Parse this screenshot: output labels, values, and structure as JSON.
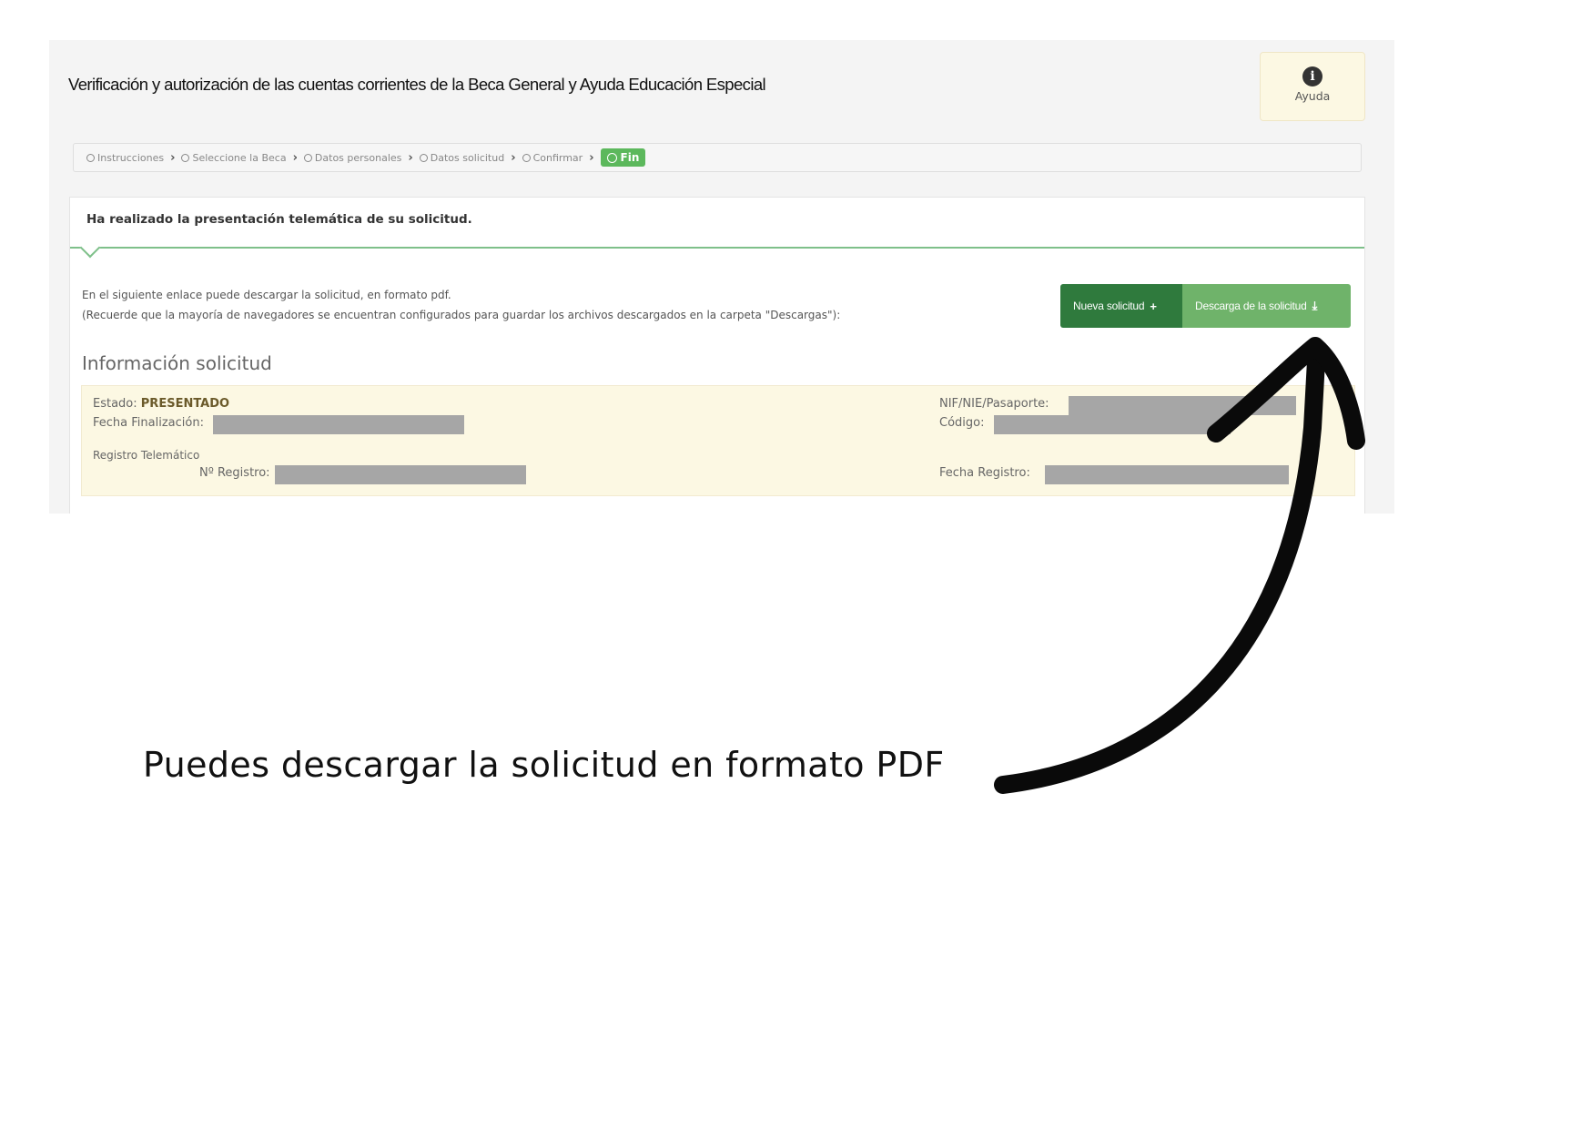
{
  "app": {
    "title": "Verificación y autorización de las cuentas corrientes de la Beca General y Ayuda Educación Especial",
    "help_label": "Ayuda",
    "help_icon": "info-circle-icon"
  },
  "steps": {
    "items": [
      {
        "label": "Instrucciones"
      },
      {
        "label": "Seleccione la Beca"
      },
      {
        "label": "Datos personales"
      },
      {
        "label": "Datos solicitud"
      },
      {
        "label": "Confirmar"
      }
    ],
    "current": "Fin"
  },
  "panel": {
    "heading": "Ha realizado la presentación telemática de su solicitud.",
    "line1": "En el siguiente enlace puede descargar la solicitud, en formato pdf.",
    "line2": "(Recuerde que la mayoría de navegadores se encuentran configurados para guardar los archivos descargados en la carpeta \"Descargas\"):",
    "buttons": {
      "new_label": "Nueva solicitud",
      "new_icon": "+",
      "download_label": "Descarga de la solicitud",
      "download_icon": "⤓"
    }
  },
  "info": {
    "section_title": "Información solicitud",
    "estado_label": "Estado:",
    "estado_value": "PRESENTADO",
    "fecha_fin_label": "Fecha Finalización:",
    "registro_heading": "Registro Telemático",
    "num_registro_label": "Nº Registro:",
    "nif_label": "NIF/NIE/Pasaporte:",
    "codigo_label": "Código:",
    "fecha_registro_label": "Fecha Registro:"
  },
  "annotation": {
    "caption": "Puedes descargar la solicitud en formato PDF"
  },
  "colors": {
    "primary_green": "#2f7a3d",
    "light_green": "#6fb36a",
    "step_active": "#5cb85c",
    "notice_bg": "#fcf8e3",
    "redaction": "#a6a6a6"
  }
}
